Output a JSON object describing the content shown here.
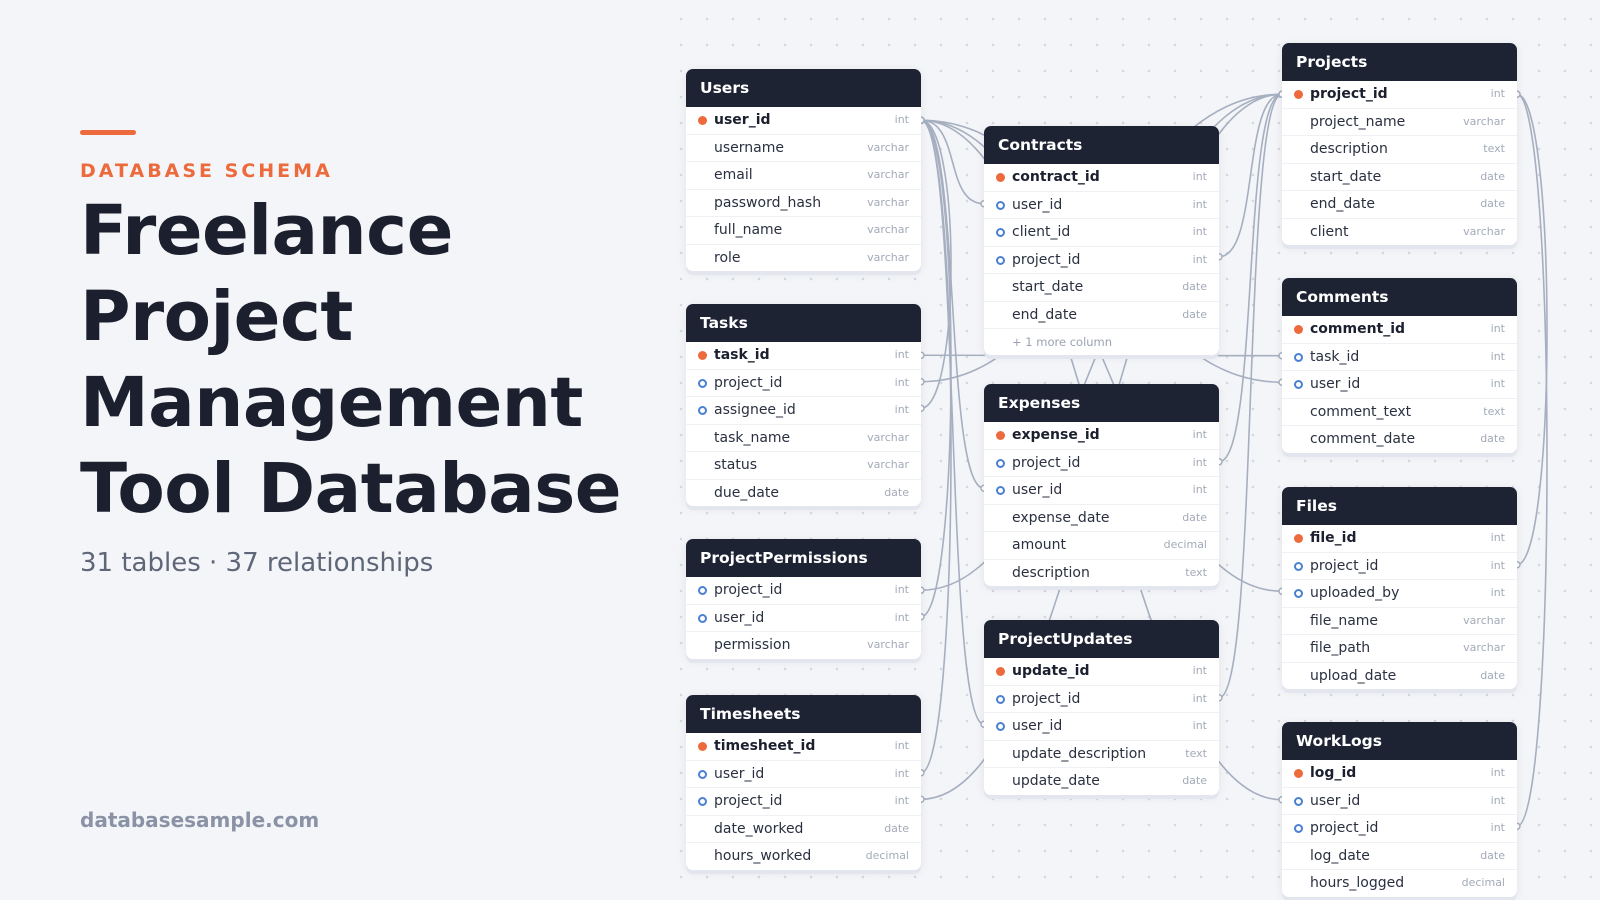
{
  "header": {
    "eyebrow": "DATABASE SCHEMA",
    "title": "Freelance Project Management Tool Database",
    "stats": "31 tables · 37 relationships",
    "site": "databasesample.com"
  },
  "colors": {
    "accent": "#ec6a3c",
    "table_header": "#1e2334",
    "foreign_key": "#4a80d4",
    "link": "#a6afc0"
  },
  "tables": [
    {
      "id": "users",
      "name": "Users",
      "columns": [
        {
          "name": "user_id",
          "type": "int",
          "key": "pk"
        },
        {
          "name": "username",
          "type": "varchar",
          "key": ""
        },
        {
          "name": "email",
          "type": "varchar",
          "key": ""
        },
        {
          "name": "password_hash",
          "type": "varchar",
          "key": ""
        },
        {
          "name": "full_name",
          "type": "varchar",
          "key": ""
        },
        {
          "name": "role",
          "type": "varchar",
          "key": ""
        }
      ],
      "more": ""
    },
    {
      "id": "tasks",
      "name": "Tasks",
      "columns": [
        {
          "name": "task_id",
          "type": "int",
          "key": "pk"
        },
        {
          "name": "project_id",
          "type": "int",
          "key": "fk"
        },
        {
          "name": "assignee_id",
          "type": "int",
          "key": "fk"
        },
        {
          "name": "task_name",
          "type": "varchar",
          "key": ""
        },
        {
          "name": "status",
          "type": "varchar",
          "key": ""
        },
        {
          "name": "due_date",
          "type": "date",
          "key": ""
        }
      ],
      "more": ""
    },
    {
      "id": "projectpermissions",
      "name": "ProjectPermissions",
      "columns": [
        {
          "name": "project_id",
          "type": "int",
          "key": "fk"
        },
        {
          "name": "user_id",
          "type": "int",
          "key": "fk"
        },
        {
          "name": "permission",
          "type": "varchar",
          "key": ""
        }
      ],
      "more": ""
    },
    {
      "id": "timesheets",
      "name": "Timesheets",
      "columns": [
        {
          "name": "timesheet_id",
          "type": "int",
          "key": "pk"
        },
        {
          "name": "user_id",
          "type": "int",
          "key": "fk"
        },
        {
          "name": "project_id",
          "type": "int",
          "key": "fk"
        },
        {
          "name": "date_worked",
          "type": "date",
          "key": ""
        },
        {
          "name": "hours_worked",
          "type": "decimal",
          "key": ""
        }
      ],
      "more": ""
    },
    {
      "id": "contracts",
      "name": "Contracts",
      "columns": [
        {
          "name": "contract_id",
          "type": "int",
          "key": "pk"
        },
        {
          "name": "user_id",
          "type": "int",
          "key": "fk"
        },
        {
          "name": "client_id",
          "type": "int",
          "key": "fk"
        },
        {
          "name": "project_id",
          "type": "int",
          "key": "fk"
        },
        {
          "name": "start_date",
          "type": "date",
          "key": ""
        },
        {
          "name": "end_date",
          "type": "date",
          "key": ""
        }
      ],
      "more": "+ 1 more column"
    },
    {
      "id": "expenses",
      "name": "Expenses",
      "columns": [
        {
          "name": "expense_id",
          "type": "int",
          "key": "pk"
        },
        {
          "name": "project_id",
          "type": "int",
          "key": "fk"
        },
        {
          "name": "user_id",
          "type": "int",
          "key": "fk"
        },
        {
          "name": "expense_date",
          "type": "date",
          "key": ""
        },
        {
          "name": "amount",
          "type": "decimal",
          "key": ""
        },
        {
          "name": "description",
          "type": "text",
          "key": ""
        }
      ],
      "more": ""
    },
    {
      "id": "projectupdates",
      "name": "ProjectUpdates",
      "columns": [
        {
          "name": "update_id",
          "type": "int",
          "key": "pk"
        },
        {
          "name": "project_id",
          "type": "int",
          "key": "fk"
        },
        {
          "name": "user_id",
          "type": "int",
          "key": "fk"
        },
        {
          "name": "update_description",
          "type": "text",
          "key": ""
        },
        {
          "name": "update_date",
          "type": "date",
          "key": ""
        }
      ],
      "more": ""
    },
    {
      "id": "projects",
      "name": "Projects",
      "columns": [
        {
          "name": "project_id",
          "type": "int",
          "key": "pk"
        },
        {
          "name": "project_name",
          "type": "varchar",
          "key": ""
        },
        {
          "name": "description",
          "type": "text",
          "key": ""
        },
        {
          "name": "start_date",
          "type": "date",
          "key": ""
        },
        {
          "name": "end_date",
          "type": "date",
          "key": ""
        },
        {
          "name": "client",
          "type": "varchar",
          "key": ""
        }
      ],
      "more": ""
    },
    {
      "id": "comments",
      "name": "Comments",
      "columns": [
        {
          "name": "comment_id",
          "type": "int",
          "key": "pk"
        },
        {
          "name": "task_id",
          "type": "int",
          "key": "fk"
        },
        {
          "name": "user_id",
          "type": "int",
          "key": "fk"
        },
        {
          "name": "comment_text",
          "type": "text",
          "key": ""
        },
        {
          "name": "comment_date",
          "type": "date",
          "key": ""
        }
      ],
      "more": ""
    },
    {
      "id": "files",
      "name": "Files",
      "columns": [
        {
          "name": "file_id",
          "type": "int",
          "key": "pk"
        },
        {
          "name": "project_id",
          "type": "int",
          "key": "fk"
        },
        {
          "name": "uploaded_by",
          "type": "int",
          "key": "fk"
        },
        {
          "name": "file_name",
          "type": "varchar",
          "key": ""
        },
        {
          "name": "file_path",
          "type": "varchar",
          "key": ""
        },
        {
          "name": "upload_date",
          "type": "date",
          "key": ""
        }
      ],
      "more": ""
    },
    {
      "id": "worklogs",
      "name": "WorkLogs",
      "columns": [
        {
          "name": "log_id",
          "type": "int",
          "key": "pk"
        },
        {
          "name": "user_id",
          "type": "int",
          "key": "fk"
        },
        {
          "name": "project_id",
          "type": "int",
          "key": "fk"
        },
        {
          "name": "log_date",
          "type": "date",
          "key": ""
        },
        {
          "name": "hours_logged",
          "type": "decimal",
          "key": ""
        }
      ],
      "more": ""
    }
  ],
  "relationships": [
    {
      "from": "contracts.user_id",
      "to": "users.user_id"
    },
    {
      "from": "contracts.project_id",
      "to": "projects.project_id"
    },
    {
      "from": "tasks.project_id",
      "to": "projects.project_id"
    },
    {
      "from": "tasks.assignee_id",
      "to": "users.user_id"
    },
    {
      "from": "projectpermissions.project_id",
      "to": "projects.project_id"
    },
    {
      "from": "projectpermissions.user_id",
      "to": "users.user_id"
    },
    {
      "from": "timesheets.user_id",
      "to": "users.user_id"
    },
    {
      "from": "timesheets.project_id",
      "to": "projects.project_id"
    },
    {
      "from": "expenses.project_id",
      "to": "projects.project_id"
    },
    {
      "from": "expenses.user_id",
      "to": "users.user_id"
    },
    {
      "from": "projectupdates.project_id",
      "to": "projects.project_id"
    },
    {
      "from": "projectupdates.user_id",
      "to": "users.user_id"
    },
    {
      "from": "comments.task_id",
      "to": "tasks.task_id"
    },
    {
      "from": "comments.user_id",
      "to": "users.user_id"
    },
    {
      "from": "files.project_id",
      "to": "projects.project_id"
    },
    {
      "from": "files.uploaded_by",
      "to": "users.user_id"
    },
    {
      "from": "worklogs.user_id",
      "to": "users.user_id"
    },
    {
      "from": "worklogs.project_id",
      "to": "projects.project_id"
    }
  ]
}
